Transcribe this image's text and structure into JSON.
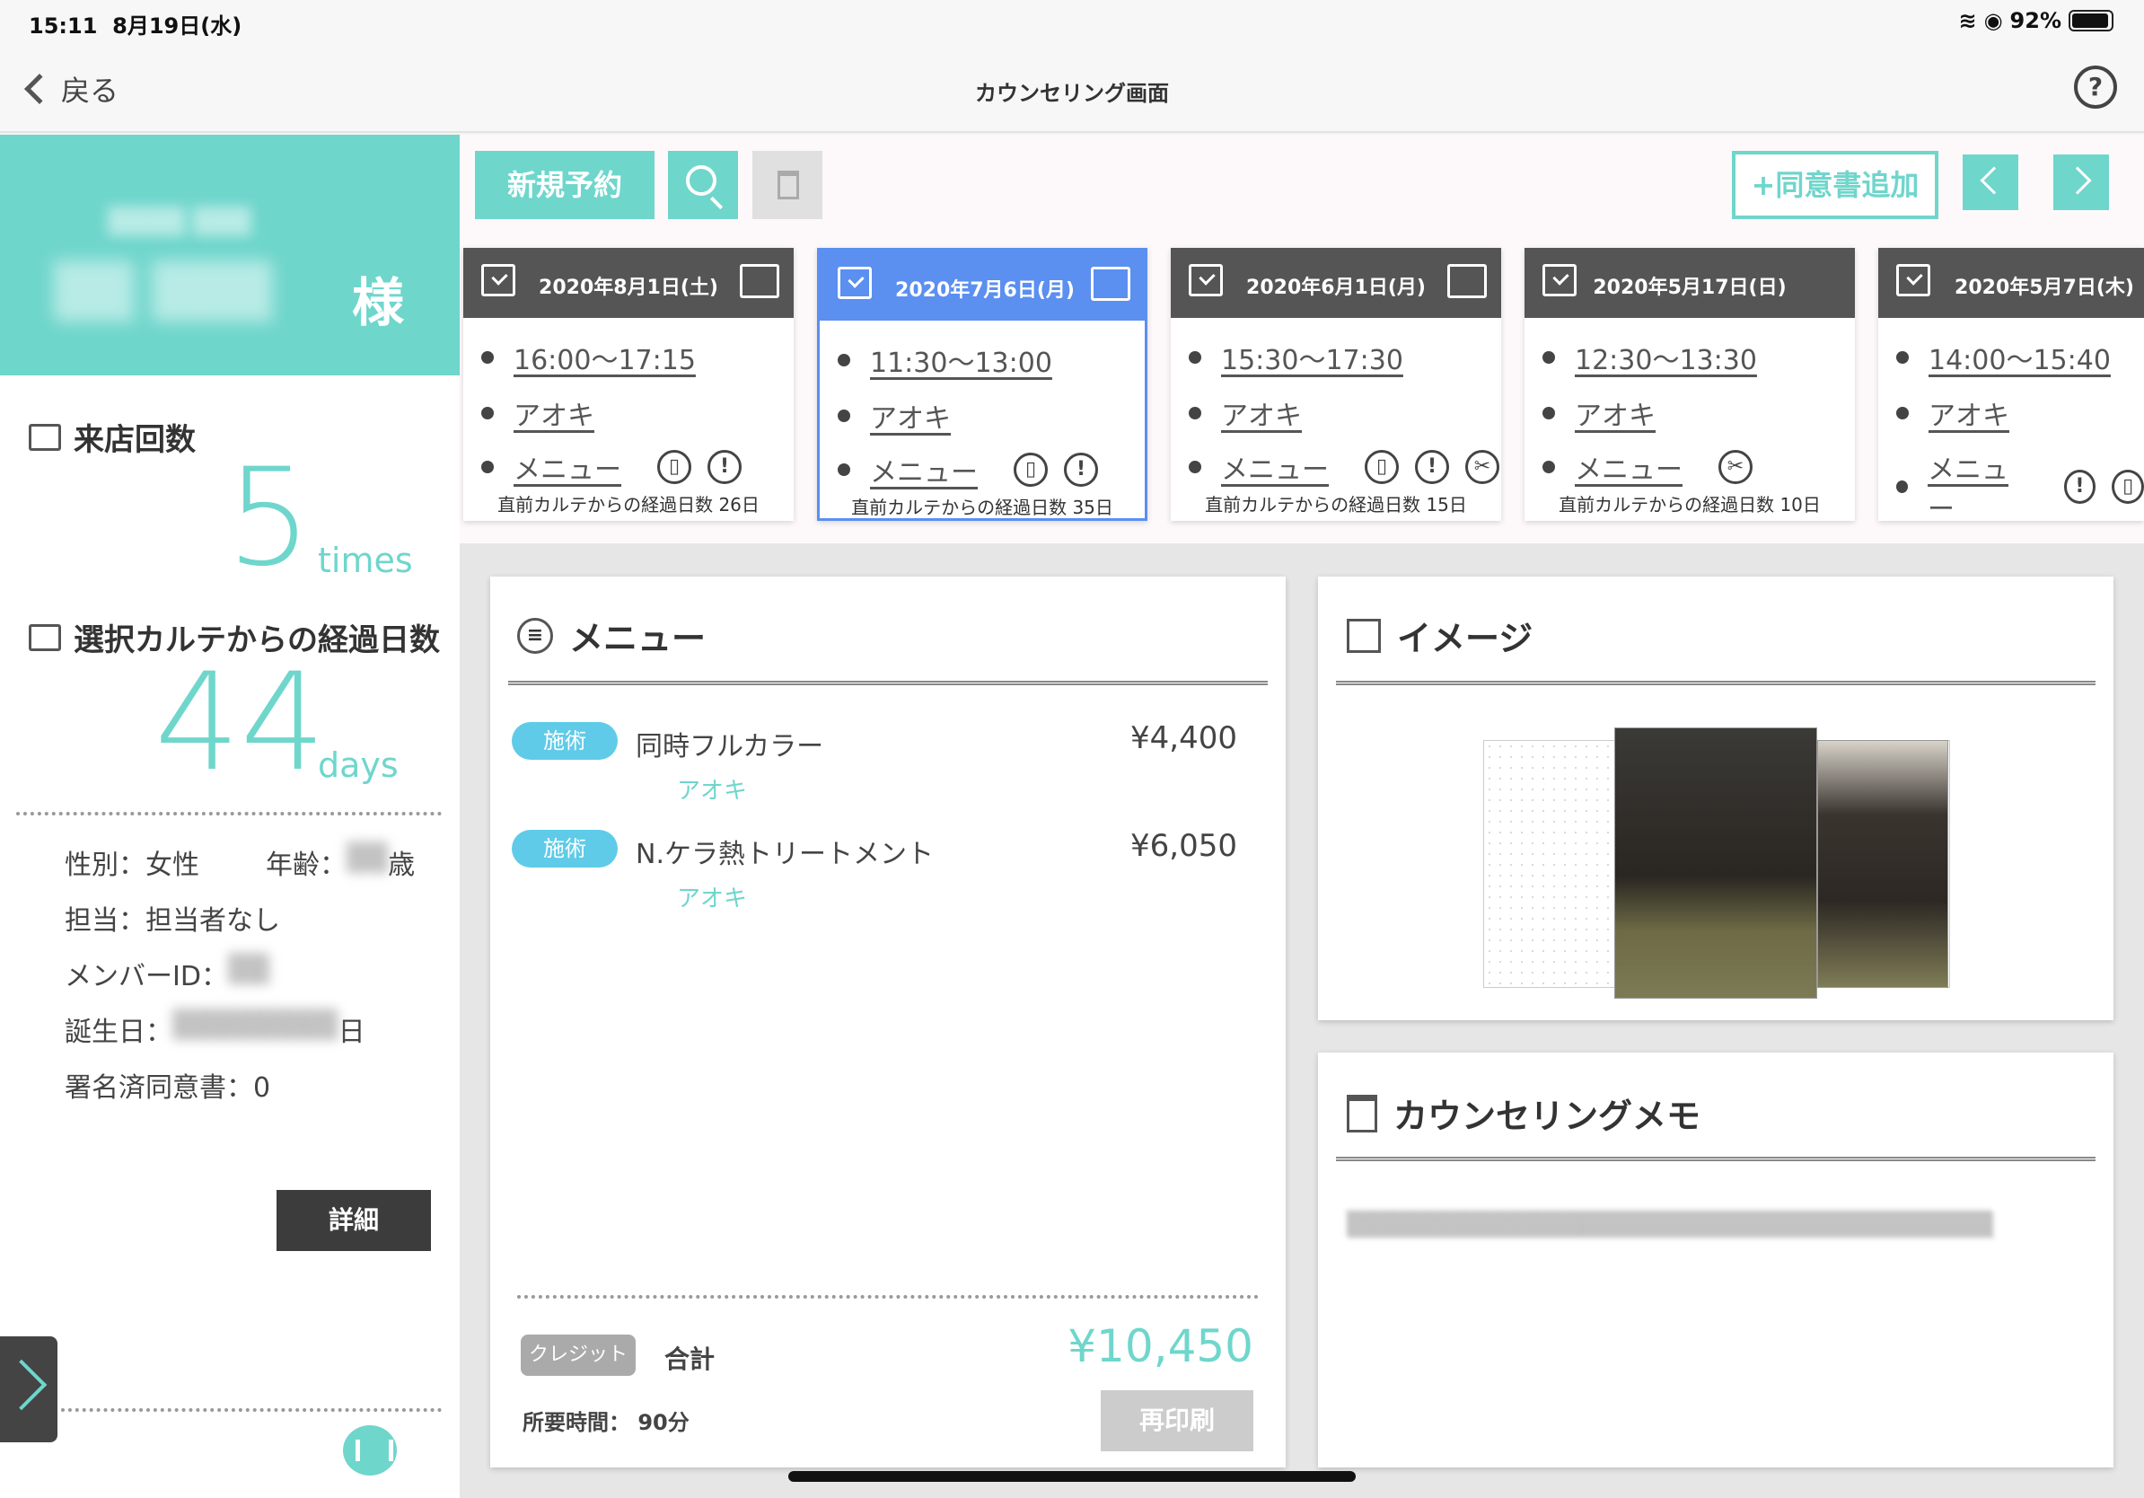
{
  "status_bar": {
    "time": "15:11",
    "date": "8月19日(水)",
    "battery": "92%"
  },
  "nav": {
    "back_label": "戻る",
    "title": "カウンセリング画面",
    "help_label": "?"
  },
  "customer": {
    "kana": "▒▒▒▒ ▒▒▒",
    "name": "▒▒ ▒▒▒",
    "honorific": "様",
    "visits_label": "来店回数",
    "visits_value": "5",
    "visits_unit": "times",
    "days_label": "選択カルテからの経過日数",
    "days_value": "44",
    "days_unit": "days",
    "gender": "性別：女性",
    "age_label": "年齢：",
    "age_value": "▒▒",
    "age_suffix": "歳",
    "staff": "担当：担当者なし",
    "member_label": "メンバーID：",
    "member_value": "▒▒",
    "birthday_label": "誕生日：",
    "birthday_value": "▒▒▒▒▒▒▒▒",
    "birthday_suffix": "日",
    "signed": "署名済同意書：0",
    "detail_button": "詳細"
  },
  "toolbar": {
    "new_reservation": "新規予約",
    "add_consent": "+同意書追加"
  },
  "cards": [
    {
      "date": "2020年8月1日(土)",
      "time": "16:00〜17:15",
      "staff": "アオキ",
      "menu": "メニュー",
      "icons": [
        "bottle-icon",
        "exclaim-icon"
      ],
      "elapsed": "直前カルテからの経過日数 26日",
      "selected": false
    },
    {
      "date": "2020年7月6日(月)",
      "time": "11:30〜13:00",
      "staff": "アオキ",
      "menu": "メニュー",
      "icons": [
        "bottle-icon",
        "exclaim-icon"
      ],
      "elapsed": "直前カルテからの経過日数 35日",
      "selected": true
    },
    {
      "date": "2020年6月1日(月)",
      "time": "15:30〜17:30",
      "staff": "アオキ",
      "menu": "メニュー",
      "icons": [
        "bottle-icon",
        "exclaim-icon",
        "scissors-icon"
      ],
      "elapsed": "直前カルテからの経過日数 15日",
      "selected": false
    },
    {
      "date": "2020年5月17日(日)",
      "time": "12:30〜13:30",
      "staff": "アオキ",
      "menu": "メニュー",
      "icons": [
        "scissors-icon"
      ],
      "elapsed": "直前カルテからの経過日数 10日",
      "selected": false
    },
    {
      "date": "2020年5月7日(木)",
      "time": "14:00〜15:40",
      "staff": "アオキ",
      "menu": "メニュー",
      "icons": [
        "exclaim-icon",
        "bottle-icon"
      ],
      "elapsed": "",
      "selected": false
    }
  ],
  "menu_panel": {
    "title": "メニュー",
    "items": [
      {
        "badge": "施術",
        "name": "同時フルカラー",
        "staff": "アオキ",
        "price": "¥4,400"
      },
      {
        "badge": "施術",
        "name": "N.ケラ熱トリートメント",
        "staff": "アオキ",
        "price": "¥6,050"
      }
    ],
    "payment_badge": "クレジット",
    "total_label": "合計",
    "total_value": "¥10,450",
    "duration": "所要時間： 90分",
    "reprint": "再印刷"
  },
  "image_panel": {
    "title": "イメージ"
  },
  "memo_panel": {
    "title": "カウンセリングメモ",
    "text": "▒▒▒▒▒▒▒▒▒▒▒▒▒▒▒▒▒▒▒▒▒▒▒▒▒▒▒▒▒▒▒▒▒▒▒▒"
  }
}
